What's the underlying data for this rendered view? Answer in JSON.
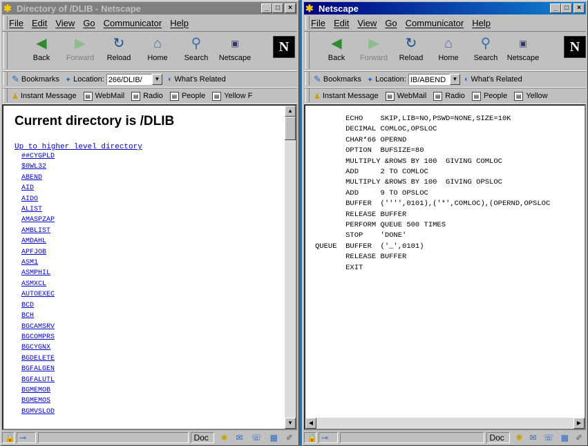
{
  "left_window": {
    "title": "Directory of /DLIB - Netscape",
    "menu": [
      "File",
      "Edit",
      "View",
      "Go",
      "Communicator",
      "Help"
    ],
    "nav": {
      "back": "Back",
      "forward": "Forward",
      "reload": "Reload",
      "home": "Home",
      "search": "Search",
      "netscape": "Netscape"
    },
    "bookmarks": "Bookmarks",
    "location_label": "Location:",
    "location_value": "266/DLIB/",
    "whats_related": "What's Related",
    "personal": {
      "im": "Instant Message",
      "webmail": "WebMail",
      "radio": "Radio",
      "people": "People",
      "yellow": "Yellow F"
    },
    "page": {
      "heading": "Current directory is /DLIB",
      "up_link": "Up to higher level directory",
      "entries": [
        "##CYGPLD",
        "$0WL32",
        "ABEND",
        "AID",
        "AIDO",
        "ALIST",
        "AMASPZAP",
        "AMBLIST",
        "AMDAHL",
        "APFJOB",
        "ASM1",
        "ASMPHIL",
        "ASMXCL",
        "AUTOEXEC",
        "BCD",
        "BCH",
        "BGCAMSRV",
        "BGCOMPRS",
        "BGCYGNX",
        "BGDELETE",
        "BGFALGEN",
        "BGFALUTL",
        "BGMEMOB",
        "BGMEMOS",
        "BGMVSLOD"
      ]
    },
    "status": {
      "doc": "Doc"
    }
  },
  "right_window": {
    "title": "Netscape",
    "menu": [
      "File",
      "Edit",
      "View",
      "Go",
      "Communicator",
      "Help"
    ],
    "nav": {
      "back": "Back",
      "forward": "Forward",
      "reload": "Reload",
      "home": "Home",
      "search": "Search",
      "netscape": "Netscape"
    },
    "bookmarks": "Bookmarks",
    "location_label": "Location:",
    "location_value": "IB/ABEND",
    "whats_related": "What's Related",
    "personal": {
      "im": "Instant Message",
      "webmail": "WebMail",
      "radio": "Radio",
      "people": "People",
      "yellow": "Yellow"
    },
    "code_lines": [
      "       ECHO    SKIP,LIB=NO,PSWD=NONE,SIZE=10K",
      "       DECIMAL COMLOC,OPSLOC",
      "       CHAR*66 OPERND",
      "       OPTION  BUFSIZE=80",
      "       MULTIPLY &ROWS BY 100  GIVING COMLOC",
      "       ADD     2 TO COMLOC",
      "       MULTIPLY &ROWS BY 100  GIVING OPSLOC",
      "       ADD     9 TO OPSLOC",
      "       BUFFER  ('''',0101),('*',COMLOC),(OPERND,OPSLOC",
      "       RELEASE BUFFER",
      "       PERFORM QUEUE 500 TIMES",
      "       STOP    'DONE'",
      "QUEUE  BUFFER  ('_',0101)",
      "       RELEASE BUFFER",
      "       EXIT"
    ],
    "status": {
      "doc": "Doc"
    }
  },
  "colors": {
    "link": "#0000cc",
    "active_title": "#000080",
    "inactive_title": "#808080",
    "chrome": "#c0c0c0"
  }
}
